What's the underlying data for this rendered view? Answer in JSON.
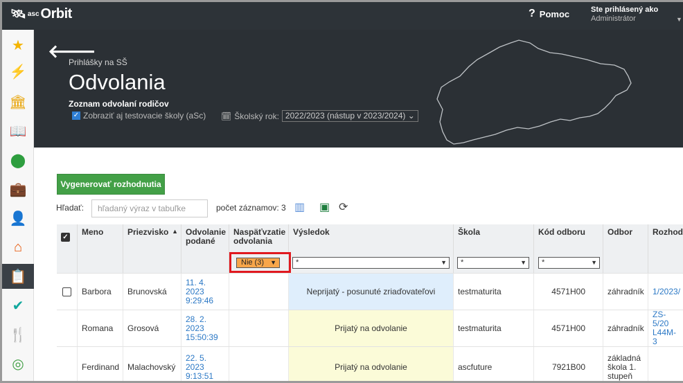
{
  "app": {
    "logo_text": "Orbit",
    "logo_prefix": "asc",
    "help_label": "Pomoc",
    "user_line1": "Ste prihlásený ako",
    "user_line2": "Administrátor"
  },
  "sidebar": {
    "items": [
      {
        "icon": "star-icon",
        "glyph": "★",
        "color": "#f4b400"
      },
      {
        "icon": "magic-wand-icon",
        "glyph": "✨",
        "color": "#e53935"
      },
      {
        "icon": "bank-icon",
        "glyph": "🏛",
        "color": "#e8a200"
      },
      {
        "icon": "book-icon",
        "glyph": "📖",
        "color": "#1e6fd9"
      },
      {
        "icon": "map-pin-icon",
        "glyph": "📍",
        "color": "#2e9e3f"
      },
      {
        "icon": "briefcase-icon",
        "glyph": "💼",
        "color": "#1e88e5"
      },
      {
        "icon": "student-icon",
        "glyph": "👤",
        "color": "#ef7d16"
      },
      {
        "icon": "school-add-icon",
        "glyph": "🏫",
        "color": "#e65100"
      },
      {
        "icon": "clipboard-icon",
        "glyph": "📋",
        "color": "#ffffff"
      },
      {
        "icon": "check-badge-icon",
        "glyph": "✔",
        "color": "#12a89d"
      },
      {
        "icon": "dining-icon",
        "glyph": "🍴",
        "color": "#8e24aa"
      },
      {
        "icon": "compass-icon",
        "glyph": "🧭",
        "color": "#43a047"
      }
    ]
  },
  "hero": {
    "breadcrumb": "Prihlášky na SŠ",
    "title": "Odvolania",
    "subtitle": "Zoznam odvolaní rodičov",
    "option_label": "Zobraziť aj testovacie školy (aSc)",
    "year_label": "Školský rok:",
    "year_value": "2022/2023 (nástup v 2023/2024)"
  },
  "toolbar": {
    "generate_label": "Vygenerovať rozhodnutia",
    "search_label": "Hľadať:",
    "search_placeholder": "hľadaný výraz v tabuľke",
    "count_text": "počet záznamov: 3"
  },
  "table": {
    "headers": {
      "meno": "Meno",
      "priezvisko": "Priezvisko",
      "odvolanie": "Odvolanie podané",
      "naspat": "Naspäťvzatie odvolania",
      "vysledok": "Výsledok",
      "skola": "Škola",
      "kod": "Kód odboru",
      "odbor": "Odbor",
      "rozhod": "Rozhod"
    },
    "filters": {
      "naspat": "Nie (3)",
      "vysledok": "*",
      "skola": "*",
      "kod": "*"
    },
    "rows": [
      {
        "meno": "Barbora",
        "priezvisko": "Brunovská",
        "odvolanie": "11. 4. 2023 9:29:46",
        "naspat": "",
        "vysledok": "Neprijatý - posunuté zriaďovateľovi",
        "skola": "testmaturita",
        "kod": "4571H00",
        "odbor": "záhradník",
        "rozhod": "1/2023/"
      },
      {
        "meno": "Romana",
        "priezvisko": "Grosová",
        "odvolanie": "28. 2. 2023 15:50:39",
        "naspat": "",
        "vysledok": "Prijatý na odvolanie",
        "skola": "testmaturita",
        "kod": "4571H00",
        "odbor": "záhradník",
        "rozhod": "ZS-5/20 L44M-3"
      },
      {
        "meno": "Ferdinand",
        "priezvisko": "Malachovský",
        "odvolanie": "22. 5. 2023 9:13:51",
        "naspat": "",
        "vysledok": "Prijatý na odvolanie",
        "skola": "ascfuture",
        "kod": "7921B00",
        "odbor": "základná škola 1. stupeň",
        "rozhod": ""
      }
    ]
  }
}
